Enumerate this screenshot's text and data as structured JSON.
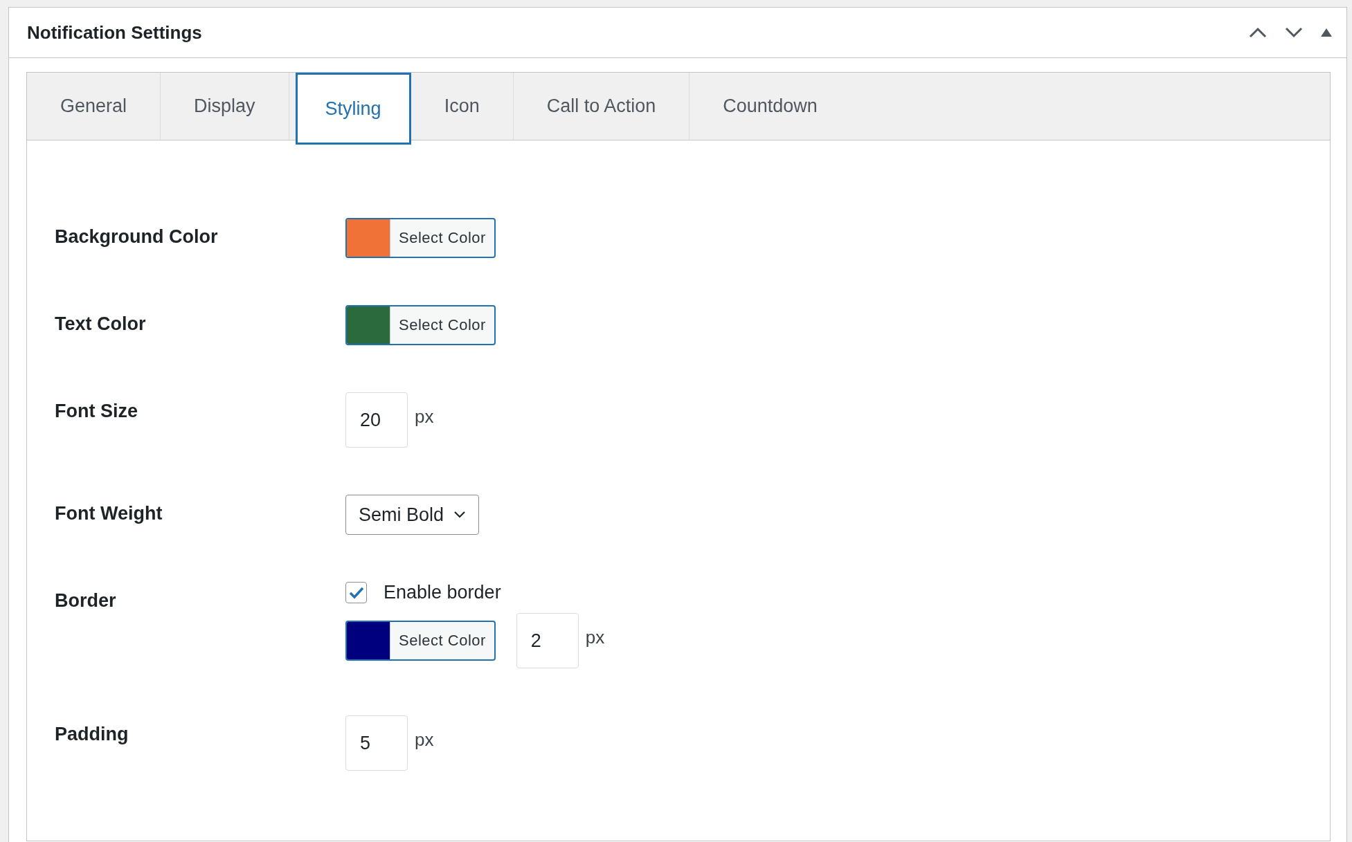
{
  "panel": {
    "title": "Notification Settings"
  },
  "tabs": [
    {
      "label": "General",
      "selected": false
    },
    {
      "label": "Display",
      "selected": false
    },
    {
      "label": "Styling",
      "selected": true
    },
    {
      "label": "Icon",
      "selected": false
    },
    {
      "label": "Call to Action",
      "selected": false
    },
    {
      "label": "Countdown",
      "selected": false
    }
  ],
  "fields": [
    {
      "label": "Background Color",
      "controls": [
        {
          "kind": "color",
          "color": "#f07237",
          "button": "Select Color"
        }
      ]
    },
    {
      "label": "Text Color",
      "controls": [
        {
          "kind": "color",
          "color": "#2b6a3c",
          "button": "Select Color"
        }
      ]
    },
    {
      "label": "Font Size",
      "controls": [
        {
          "kind": "number",
          "value": "20",
          "unit": "px"
        }
      ]
    },
    {
      "label": "Font Weight",
      "controls": [
        {
          "kind": "select",
          "value": "Semi Bold"
        }
      ]
    },
    {
      "label": "Border",
      "controls": [
        {
          "kind": "checkbox",
          "label": "Enable border",
          "checked": true
        },
        {
          "kind": "color",
          "color": "#00007f",
          "button": "Select Color"
        },
        {
          "kind": "number",
          "value": "2",
          "unit": "px"
        }
      ]
    },
    {
      "label": "Padding",
      "controls": [
        {
          "kind": "number",
          "value": "5",
          "unit": "px"
        }
      ]
    }
  ]
}
